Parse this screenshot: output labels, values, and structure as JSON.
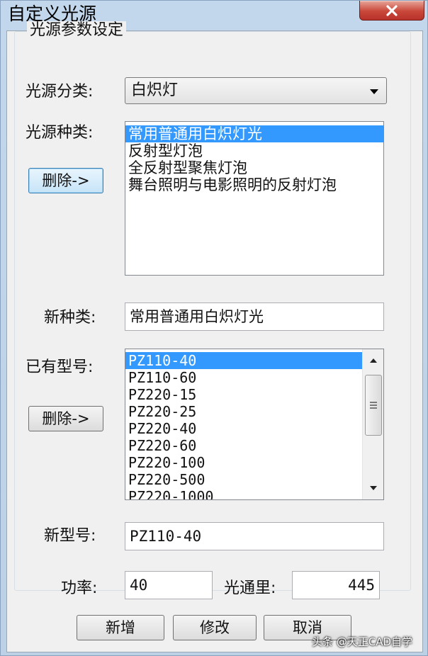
{
  "window": {
    "title": "自定义光源"
  },
  "group": {
    "label": "光源参数设定"
  },
  "light_category": {
    "label": "光源分类:",
    "value": "白炽灯"
  },
  "light_types": {
    "label": "光源种类:",
    "delete_button": "删除->",
    "items": [
      "常用普通用白炽灯光",
      "反射型灯泡",
      "全反射型聚焦灯泡",
      "舞台照明与电影照明的反射灯泡"
    ],
    "selected_index": 0
  },
  "new_type": {
    "label": "新种类:",
    "value": "常用普通用白炽灯光"
  },
  "existing_models": {
    "label": "已有型号:",
    "delete_button": "删除->",
    "items": [
      "PZ110-40",
      "PZ110-60",
      "PZ220-15",
      "PZ220-25",
      "PZ220-40",
      "PZ220-60",
      "PZ220-100",
      "PZ220-500",
      "PZ220-1000"
    ],
    "selected_index": 0
  },
  "new_model": {
    "label": "新型号:",
    "value": "PZ110-40"
  },
  "power": {
    "label": "功率:",
    "value": "40"
  },
  "luminous_flux": {
    "label": "光通里:",
    "value": "445"
  },
  "buttons": {
    "add": "新增",
    "modify": "修改",
    "cancel": "取消"
  },
  "watermark": "头条 @天正CAD自学",
  "icons": {
    "close": "close-icon",
    "dropdown": "chevron-down-icon",
    "scroll_up": "arrow-up-icon",
    "scroll_down": "arrow-down-icon",
    "scroll_grip": "grip-icon"
  },
  "colors": {
    "selection": "#3399ff",
    "close_button": "#c9473a",
    "title_bar": "#c2d6ec"
  }
}
